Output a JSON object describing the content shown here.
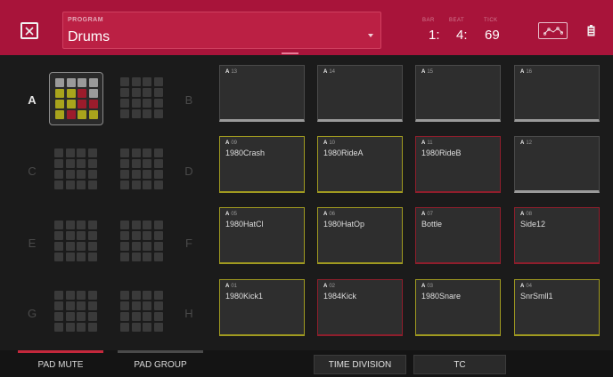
{
  "header": {
    "program_label": "PROGRAM",
    "program_value": "Drums",
    "bar_label": "BAR",
    "beat_label": "BEAT",
    "tick_label": "TICK",
    "bar_value": "1:",
    "beat_value": "4:",
    "tick_value": "69"
  },
  "banks": [
    {
      "letter": "A",
      "active": true
    },
    {
      "letter": "B",
      "active": false
    },
    {
      "letter": "C",
      "active": false
    },
    {
      "letter": "D",
      "active": false
    },
    {
      "letter": "E",
      "active": false
    },
    {
      "letter": "F",
      "active": false
    },
    {
      "letter": "G",
      "active": false
    },
    {
      "letter": "H",
      "active": false
    }
  ],
  "pads": [
    {
      "bank": "A",
      "num": "13",
      "name": "",
      "state": "plain"
    },
    {
      "bank": "A",
      "num": "14",
      "name": "",
      "state": "plain"
    },
    {
      "bank": "A",
      "num": "15",
      "name": "",
      "state": "plain"
    },
    {
      "bank": "A",
      "num": "16",
      "name": "",
      "state": "plain"
    },
    {
      "bank": "A",
      "num": "09",
      "name": "1980Crash",
      "state": "yellow"
    },
    {
      "bank": "A",
      "num": "10",
      "name": "1980RideA",
      "state": "yellow"
    },
    {
      "bank": "A",
      "num": "11",
      "name": "1980RideB",
      "state": "red"
    },
    {
      "bank": "A",
      "num": "12",
      "name": "",
      "state": "plain"
    },
    {
      "bank": "A",
      "num": "05",
      "name": "1980HatCl",
      "state": "yellow"
    },
    {
      "bank": "A",
      "num": "06",
      "name": "1980HatOp",
      "state": "yellow"
    },
    {
      "bank": "A",
      "num": "07",
      "name": "Bottle",
      "state": "red"
    },
    {
      "bank": "A",
      "num": "08",
      "name": "Side12",
      "state": "red"
    },
    {
      "bank": "A",
      "num": "01",
      "name": "1980Kick1",
      "state": "yellow"
    },
    {
      "bank": "A",
      "num": "02",
      "name": "1984Kick",
      "state": "red"
    },
    {
      "bank": "A",
      "num": "03",
      "name": "1980Snare",
      "state": "yellow"
    },
    {
      "bank": "A",
      "num": "04",
      "name": "SnrSmll1",
      "state": "yellow"
    }
  ],
  "thumb_a_colors": [
    "#9a9a9a",
    "#9a9a9a",
    "#9a9a9a",
    "#9a9a9a",
    "#a8a41c",
    "#a8a41c",
    "#9c1c2c",
    "#9a9a9a",
    "#a8a41c",
    "#a8a41c",
    "#9c1c2c",
    "#9c1c2c",
    "#a8a41c",
    "#9c1c2c",
    "#a8a41c",
    "#a8a41c"
  ],
  "footer": {
    "pad_mute": "PAD MUTE",
    "pad_group": "PAD GROUP",
    "time_division": "TIME DIVISION",
    "tc": "TC"
  },
  "colors": {
    "header": "#a8143a",
    "pad_yellow": "#a09a20",
    "pad_red": "#8f1e2c",
    "pad_mute_indicator": "#c4283c",
    "pad_group_indicator": "#4a4a4a"
  }
}
